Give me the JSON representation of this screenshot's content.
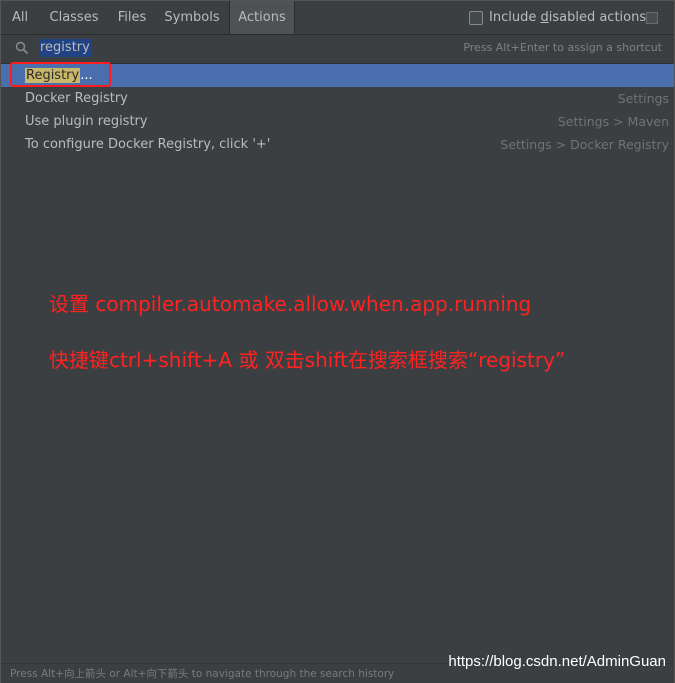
{
  "tabs": [
    {
      "label": "All"
    },
    {
      "label": "Classes"
    },
    {
      "label": "Files"
    },
    {
      "label": "Symbols"
    },
    {
      "label": "Actions",
      "active": true
    }
  ],
  "include": {
    "prefix": "Include ",
    "underlined": "d",
    "suffix": "isabled actions",
    "checked": false
  },
  "search": {
    "query": "registry",
    "hint": "Press Alt+Enter to assign a shortcut"
  },
  "results": [
    {
      "highlight": "Registry",
      "rest": "...",
      "category": "",
      "selected": true
    },
    {
      "name": "Docker Registry",
      "category": "Settings"
    },
    {
      "name": "Use plugin registry",
      "category": "Settings > Maven"
    },
    {
      "name": "To configure Docker Registry, click '+'",
      "category": "Settings > Docker Registry"
    }
  ],
  "annotation": {
    "line1": "设置 compiler.automake.allow.when.app.running",
    "line2": "快捷键ctrl+shift+A 或 双击shift在搜索框搜索“registry”"
  },
  "footer": {
    "text": "Press Alt+向上箭头 or Alt+向下箭头 to navigate through the search history"
  },
  "watermark": "https://blog.csdn.net/AdminGuan",
  "colors": {
    "background": "#3c3f41",
    "selection": "#4b6eaf",
    "match_highlight": "#c9b76a",
    "annotation_red": "#ff2222"
  }
}
